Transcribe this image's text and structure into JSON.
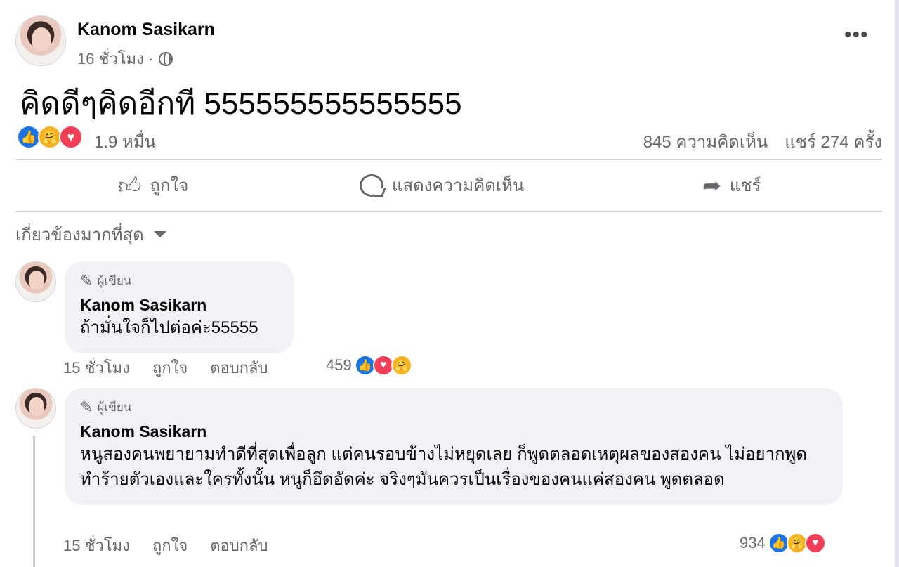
{
  "post": {
    "author": "Kanom Sasikarn",
    "time": "16 ชั่วโมง ·",
    "text": "คิดดีๆคิดอีกที 555555555555555",
    "reaction_count": "1.9 หมื่น",
    "comments_count": "845 ความคิดเห็น",
    "shares_count": "แชร์ 274 ครั้ง"
  },
  "actions": {
    "like": "ถูกใจ",
    "comment": "แสดงความคิดเห็น",
    "share": "แชร์"
  },
  "sort_label": "เกี่ยวข้องมากที่สุด",
  "comments": [
    {
      "badge": "ผู้เขียน",
      "author": "Kanom Sasikarn",
      "text": "ถ้ามั่นใจก็ไปต่อค่ะ55555",
      "time": "15 ชั่วโมง",
      "like": "ถูกใจ",
      "reply": "ตอบกลับ",
      "reactions": "459"
    },
    {
      "badge": "ผู้เขียน",
      "author": "Kanom Sasikarn",
      "text": "หนูสองคนพยายามทำดีที่สุดเพื่อลูก แต่คนรอบข้างไม่หยุดเลย ก็พูดตลอดเหตุผลของสองคน ไม่อยากพูดทำร้ายตัวเองและใครทั้งนั้น หนูก็อึดอัดค่ะ จริงๆมันควรเป็นเรื่องของคนแค่สองคน พูดตลอด",
      "time": "15 ชั่วโมง",
      "like": "ถูกใจ",
      "reply": "ตอบกลับ",
      "reactions": "934"
    }
  ],
  "icons": {
    "reactions": [
      "like-icon",
      "care-icon",
      "love-icon"
    ],
    "more": "more-icon",
    "globe": "globe-icon"
  },
  "colors": {
    "like": "#1b74e4",
    "love": "#f33e58",
    "care": "#f7b125",
    "secondary_text": "#65676b",
    "bubble_bg": "#f0f2f5"
  }
}
